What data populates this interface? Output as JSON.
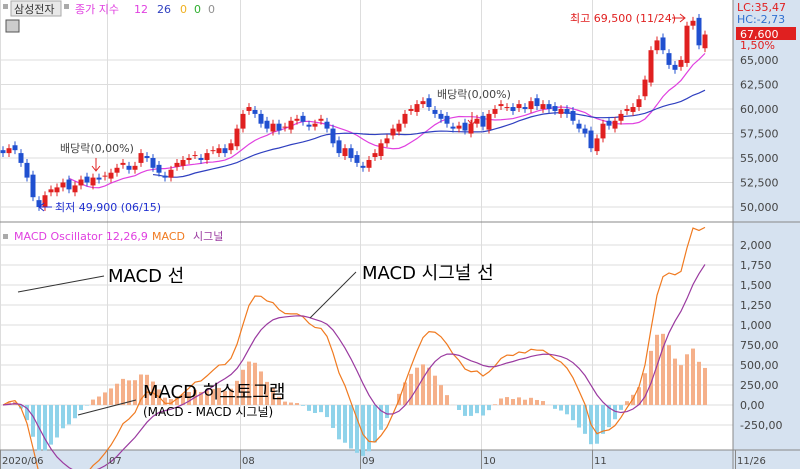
{
  "header": {
    "stock": "삼성전자",
    "ma_label": "종가 지수",
    "ma_values": [
      "12",
      "26",
      "0",
      "0",
      "0"
    ],
    "ma_colors": [
      "#e040e0",
      "#3040c0",
      "#f0b020",
      "#30b030",
      "#909090"
    ]
  },
  "price_pane": {
    "lc": "LC:35,47",
    "hc": "HC:-2,73",
    "current": "67,600",
    "change": "1,50%",
    "high_label": "최고 69,500 (11/24)",
    "low_label": "최저 49,900 (06/15)",
    "dividend_labels": [
      "배당락(0,00%)",
      "배당락(0,00%)"
    ],
    "yticks": [
      "50,000",
      "52,500",
      "55,000",
      "57,500",
      "60,000",
      "62,500",
      "65,000"
    ]
  },
  "macd_pane": {
    "title": "MACD Oscillator 12,26,9",
    "macd": "MACD",
    "signal": "시그널",
    "yticks": [
      "-250,00",
      "0,00",
      "250,00",
      "500,00",
      "750,00",
      "1,000",
      "1,250",
      "1,500",
      "1,750",
      "2,000"
    ],
    "annotations": {
      "macd_line": "MACD 선",
      "signal_line": "MACD 시그널 선",
      "histogram": "MACD 히스토그램",
      "histogram_sub": "(MACD - MACD 시그널)"
    }
  },
  "xaxis": {
    "labels": [
      "2020/06",
      "07",
      "08",
      "09",
      "10",
      "11",
      "11/26"
    ]
  },
  "chart_data": {
    "type": "candlestick+macd",
    "title": "삼성전자",
    "ma_periods": [
      12,
      26
    ],
    "macd_params": [
      12,
      26,
      9
    ],
    "closes": [
      55.5,
      56.0,
      55.8,
      54.5,
      53.0,
      51.0,
      50.0,
      51.2,
      51.8,
      52.0,
      52.5,
      51.8,
      52.2,
      52.8,
      52.5,
      53.0,
      52.8,
      53.2,
      53.5,
      54.0,
      54.5,
      53.8,
      54.2,
      55.5,
      55.0,
      54.0,
      53.5,
      53.0,
      53.8,
      54.5,
      54.8,
      55.0,
      55.3,
      54.8,
      55.5,
      55.8,
      56.0,
      55.5,
      56.5,
      58.0,
      59.5,
      60.2,
      59.5,
      58.5,
      58.0,
      58.5,
      57.8,
      58.2,
      58.8,
      59.0,
      58.7,
      58.2,
      58.5,
      59.0,
      58.0,
      56.5,
      55.5,
      56.0,
      55.0,
      54.5,
      54.0,
      54.8,
      55.5,
      56.5,
      57.0,
      58.0,
      58.5,
      59.5,
      60.0,
      60.5,
      60.8,
      60.2,
      59.5,
      59.0,
      58.5,
      58.0,
      58.3,
      57.8,
      58.5,
      59.0,
      58.2,
      59.5,
      60.0,
      60.5,
      60.2,
      59.8,
      60.5,
      60.0,
      60.8,
      60.3,
      60.5,
      60.0,
      59.8,
      60.0,
      59.5,
      58.8,
      58.0,
      57.5,
      56.0,
      57.0,
      58.5,
      58.3,
      58.8,
      59.5,
      60.0,
      60.2,
      61.0,
      63.0,
      66.0,
      67.0,
      66.0,
      64.5,
      64.0,
      65.0,
      68.5,
      69.0,
      66.5,
      67.6
    ],
    "price_unit": "thousand KRW",
    "price_ylim": [
      48500,
      70000
    ],
    "macd_ylim": [
      -400,
      2150
    ],
    "month_start_index": [
      0,
      18,
      40,
      60,
      80,
      98
    ]
  }
}
